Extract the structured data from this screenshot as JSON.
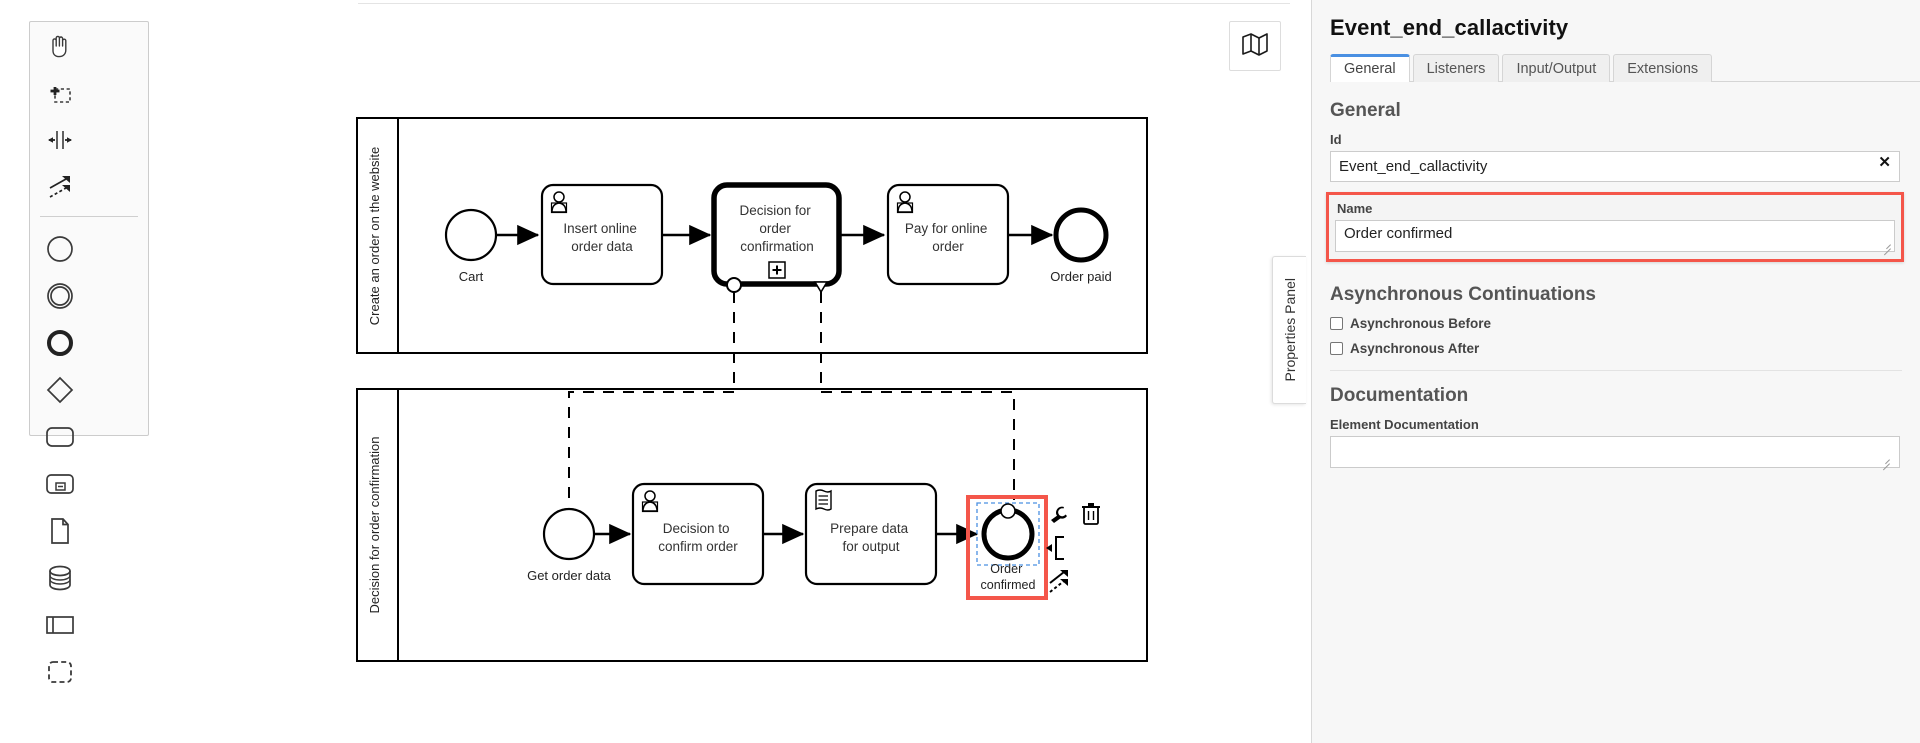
{
  "app": {
    "minimap_icon": "map-icon"
  },
  "palette": {
    "tools": [
      {
        "name": "hand-tool",
        "icon": "hand-icon"
      },
      {
        "name": "lasso-tool",
        "icon": "lasso-select-icon"
      },
      {
        "name": "space-tool",
        "icon": "space-tool-icon"
      },
      {
        "name": "global-connect-tool",
        "icon": "connect-arrows-icon"
      }
    ],
    "elements": [
      {
        "name": "create-start-event",
        "icon": "circle-thin-icon"
      },
      {
        "name": "create-intermediate-event",
        "icon": "double-circle-icon"
      },
      {
        "name": "create-end-event",
        "icon": "circle-thick-icon"
      },
      {
        "name": "create-exclusive-gateway",
        "icon": "diamond-icon"
      },
      {
        "name": "create-task",
        "icon": "rounded-rect-icon"
      },
      {
        "name": "create-subprocess-expanded",
        "icon": "subprocess-icon"
      },
      {
        "name": "create-data-object",
        "icon": "document-icon"
      },
      {
        "name": "create-data-store",
        "icon": "database-icon"
      },
      {
        "name": "create-participant",
        "icon": "pool-icon"
      },
      {
        "name": "create-group",
        "icon": "dashed-group-icon"
      }
    ]
  },
  "panel_tab": {
    "label": "Properties Panel"
  },
  "properties": {
    "title": "Event_end_callactivity",
    "tabs": [
      {
        "label": "General",
        "active": true
      },
      {
        "label": "Listeners",
        "active": false
      },
      {
        "label": "Input/Output",
        "active": false
      },
      {
        "label": "Extensions",
        "active": false
      }
    ],
    "general": {
      "heading": "General",
      "id_label": "Id",
      "id_value": "Event_end_callactivity",
      "clear_icon": "✕",
      "name_label": "Name",
      "name_value": "Order confirmed",
      "highlight_color": "#f4564a"
    },
    "async": {
      "heading": "Asynchronous Continuations",
      "before_label": "Asynchronous Before",
      "before_checked": false,
      "after_label": "Asynchronous After",
      "after_checked": false
    },
    "documentation": {
      "heading": "Documentation",
      "element_doc_label": "Element Documentation",
      "element_doc_value": ""
    }
  },
  "diagram": {
    "pools": [
      {
        "lane_label": "Create an order on the website",
        "nodes": [
          {
            "type": "start-event",
            "label": "Cart"
          },
          {
            "type": "user-task",
            "label": "Insert online order data"
          },
          {
            "type": "call-activity",
            "label": "Decision for order confirmation",
            "marker": "+"
          },
          {
            "type": "user-task",
            "label": "Pay for online order"
          },
          {
            "type": "end-event",
            "label": "Order paid"
          }
        ]
      },
      {
        "lane_label": "Decision for order confirmation",
        "nodes": [
          {
            "type": "start-event",
            "label": "Get order data"
          },
          {
            "type": "user-task",
            "label": "Decision to confirm order"
          },
          {
            "type": "script-task",
            "label": "Prepare data for output"
          },
          {
            "type": "end-event",
            "label": "Order confirmed",
            "selected": true
          }
        ]
      }
    ],
    "context_pad": [
      {
        "name": "wrench-icon"
      },
      {
        "name": "delete-trash-icon"
      },
      {
        "name": "append-bracket-icon"
      },
      {
        "name": "connect-arrows-icon"
      }
    ]
  }
}
